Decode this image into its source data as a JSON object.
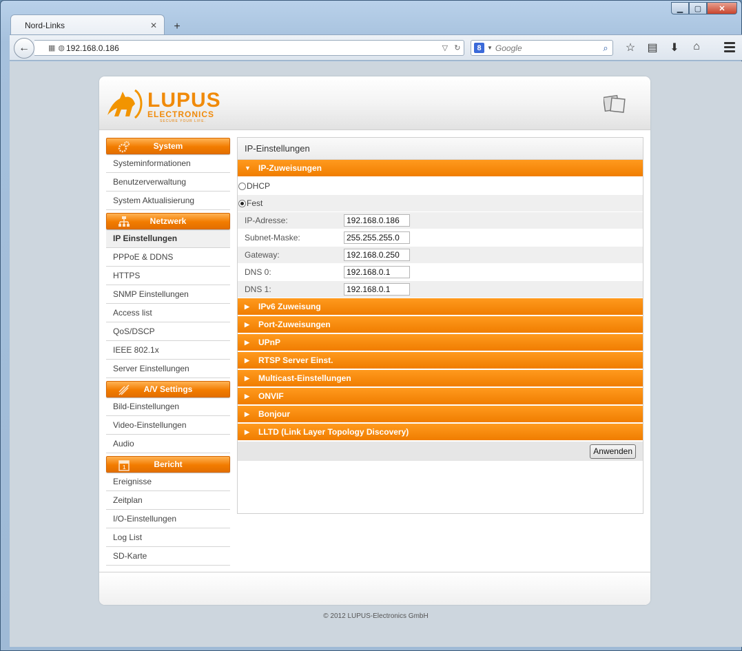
{
  "browser": {
    "tab_title": "Nord-Links",
    "tab_close": "✕",
    "new_tab": "+",
    "url": "192.168.0.186",
    "search_engine_letter": "8",
    "search_placeholder": "Google"
  },
  "logo": {
    "brand": "LUPUS",
    "sub": "ELECTRONICS",
    "tagline": "SECURE YOUR LIFE."
  },
  "sidebar": {
    "sections": [
      {
        "title": "System",
        "icon": "gears-icon",
        "items": [
          "Systeminformationen",
          "Benutzerverwaltung",
          "System Aktualisierung"
        ]
      },
      {
        "title": "Netzwerk",
        "icon": "network-icon",
        "items": [
          "IP Einstellungen",
          "PPPoE & DDNS",
          "HTTPS",
          "SNMP Einstellungen",
          "Access list",
          "QoS/DSCP",
          "IEEE 802.1x",
          "Server Einstellungen"
        ]
      },
      {
        "title": "A/V Settings",
        "icon": "antenna-icon",
        "items": [
          "Bild-Einstellungen",
          "Video-Einstellungen",
          "Audio"
        ]
      },
      {
        "title": "Bericht",
        "icon": "calendar-icon",
        "items": [
          "Ereignisse",
          "Zeitplan",
          "I/O-Einstellungen",
          "Log List",
          "SD-Karte"
        ]
      }
    ],
    "active_item": "IP Einstellungen"
  },
  "content": {
    "title": "IP-Einstellungen",
    "open_section": "IP-Zuweisungen",
    "dhcp_label": "DHCP",
    "fest_label": "Fest",
    "mode": "Fest",
    "fields": [
      {
        "label": "IP-Adresse:",
        "value": "192.168.0.186"
      },
      {
        "label": "Subnet-Maske:",
        "value": "255.255.255.0"
      },
      {
        "label": "Gateway:",
        "value": "192.168.0.250"
      },
      {
        "label": "DNS 0:",
        "value": "192.168.0.1"
      },
      {
        "label": "DNS 1:",
        "value": "192.168.0.1"
      }
    ],
    "collapsed_sections": [
      "IPv6 Zuweisung",
      "Port-Zuweisungen",
      "UPnP",
      "RTSP Server Einst.",
      "Multicast-Einstellungen",
      "ONVIF",
      "Bonjour",
      "LLTD (Link Layer Topology Discovery)"
    ],
    "apply_button": "Anwenden"
  },
  "footer": {
    "copyright": "© 2012 LUPUS-Electronics GmbH"
  },
  "colors": {
    "accent": "#f07d00",
    "accent_light": "#ff9a1e"
  }
}
